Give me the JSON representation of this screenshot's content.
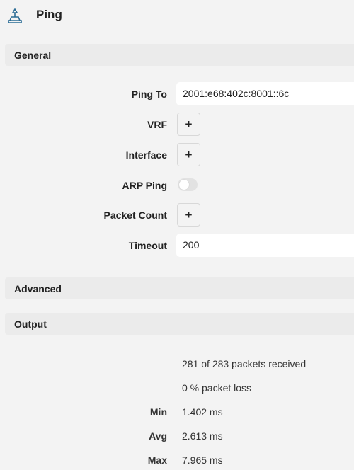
{
  "window": {
    "title": "Ping",
    "icon": "ping-tool-icon"
  },
  "sections": {
    "general": "General",
    "advanced": "Advanced",
    "output": "Output"
  },
  "form": {
    "ping_to": {
      "label": "Ping To",
      "value": "2001:e68:402c:8001::6c"
    },
    "vrf": {
      "label": "VRF",
      "button": "+"
    },
    "interface": {
      "label": "Interface",
      "button": "+"
    },
    "arp_ping": {
      "label": "ARP Ping",
      "enabled": false
    },
    "packet_count": {
      "label": "Packet Count",
      "button": "+"
    },
    "timeout": {
      "label": "Timeout",
      "value": "200"
    }
  },
  "output": {
    "received": "281 of 283 packets received",
    "loss": "0 % packet loss",
    "min": {
      "label": "Min",
      "value": "1.402 ms"
    },
    "avg": {
      "label": "Avg",
      "value": "2.613 ms"
    },
    "max": {
      "label": "Max",
      "value": "7.965 ms"
    }
  },
  "colors": {
    "background": "#f3f3f3",
    "section_bar": "#ebebeb",
    "field": "#ffffff",
    "text": "#222222"
  }
}
